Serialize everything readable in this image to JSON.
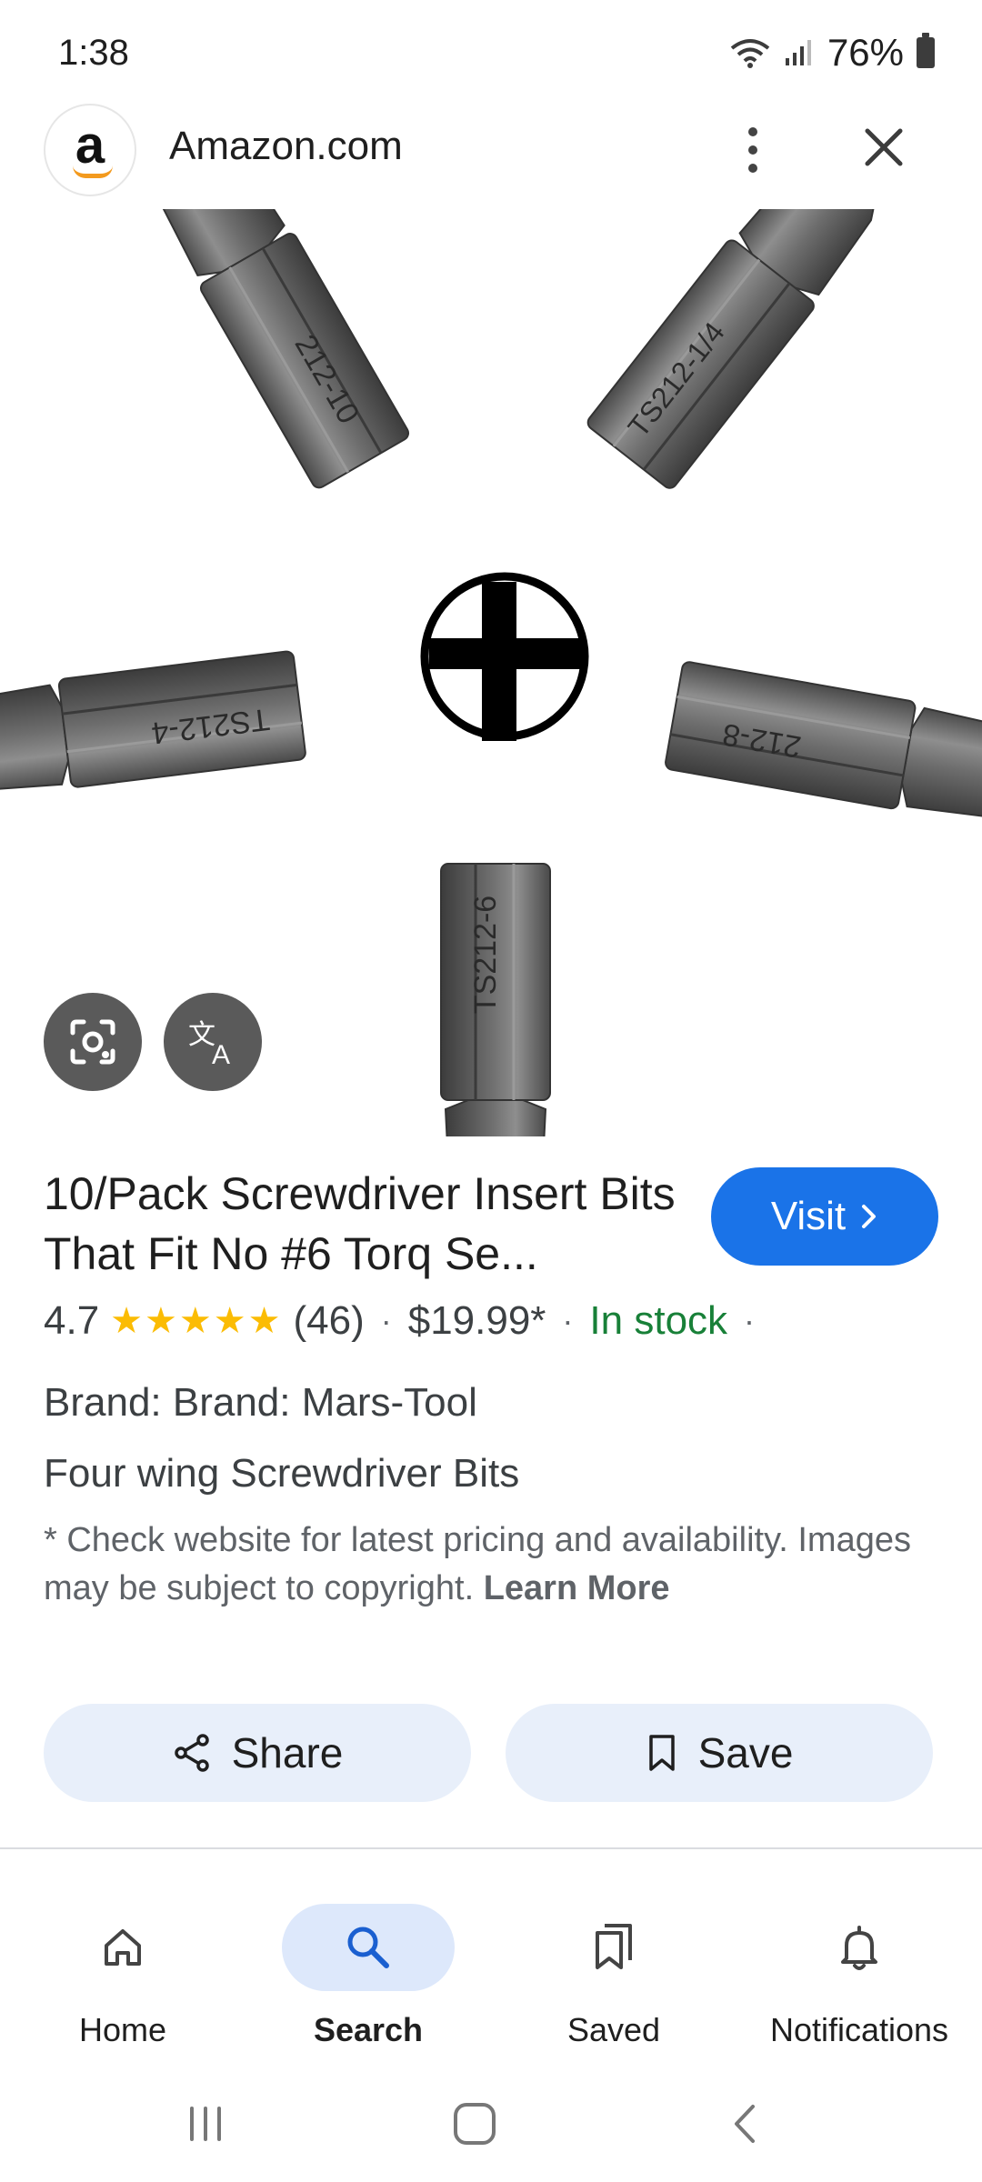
{
  "status_bar": {
    "time": "1:38",
    "battery": "76%"
  },
  "header": {
    "logo_letter": "a",
    "site_name": "Amazon.com"
  },
  "image": {
    "bit_labels": [
      "212-10",
      "TS212-1/4",
      "TS212-4",
      "212-8",
      "TS212-6"
    ]
  },
  "product": {
    "title": "10/Pack Screwdriver Insert Bits That Fit No #6 Torq Se...",
    "visit_label": "Visit",
    "rating": "4.7",
    "stars": "★★★★★",
    "review_count": "(46)",
    "price": "$19.99*",
    "availability": "In stock",
    "brand": "Brand: Brand: Mars-Tool",
    "description": "Four wing Screwdriver Bits",
    "disclaimer": "* Check website for latest pricing and availability. Images may be subject to copyright.",
    "learn_more": "Learn More"
  },
  "actions": {
    "share_label": "Share",
    "save_label": "Save"
  },
  "bottom_nav": {
    "items": [
      {
        "label": "Home",
        "icon": "home-icon"
      },
      {
        "label": "Search",
        "icon": "search-icon",
        "active": true
      },
      {
        "label": "Saved",
        "icon": "saved-icon"
      },
      {
        "label": "Notifications",
        "icon": "bell-icon"
      }
    ]
  },
  "colors": {
    "accent": "#1a73e8",
    "in_stock": "#188038",
    "star": "#fbbc04",
    "pill_bg": "#e8effa"
  }
}
